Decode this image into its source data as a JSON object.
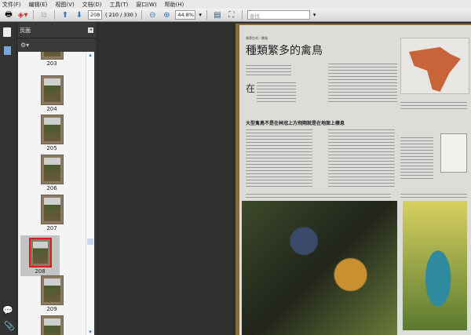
{
  "menu": [
    "文件(F)",
    "编辑(E)",
    "视图(V)",
    "文档(D)",
    "工具(T)",
    "窗口(W)",
    "帮助(H)"
  ],
  "toolbar": {
    "page_current": "208",
    "page_total": "( 210 / 330 )",
    "zoom": "44.8%",
    "search_placeholder": "查找"
  },
  "panel": {
    "title": "页面"
  },
  "thumbnails": [
    {
      "label": "203"
    },
    {
      "label": "204"
    },
    {
      "label": "205"
    },
    {
      "label": "206"
    },
    {
      "label": "207"
    },
    {
      "label": "208",
      "selected": true
    },
    {
      "label": "209"
    }
  ],
  "document": {
    "section": "林莽古木／禽鳥",
    "title": "種類繁多的禽鳥",
    "subheading": "大型禽鳥不是在林冠上方飛翔就是在地面上棲息",
    "dropcap": "在"
  },
  "colors": {
    "selection_border": "#d42020",
    "map": "#c8643a"
  }
}
